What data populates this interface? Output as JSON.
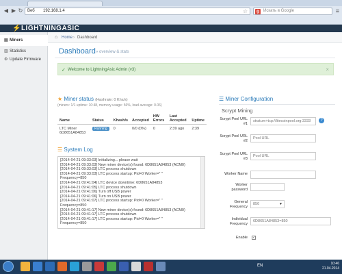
{
  "browser": {
    "site_label": "Веб",
    "url": "192.168.1.4",
    "search_placeholder": "Искать в Google"
  },
  "app": {
    "logo": "LIGHTNINGASIC"
  },
  "sidebar": {
    "items": [
      {
        "label": "Miners"
      },
      {
        "label": "Statistics"
      },
      {
        "label": "Update Firmware"
      }
    ]
  },
  "breadcrumb": {
    "home": "Home",
    "sep": "›",
    "current": "Dashboard"
  },
  "header": {
    "title": "Dashboard",
    "subtitle": "» overview & stats"
  },
  "alert": {
    "message": "Welcome to LightningAsic Admin (v3)"
  },
  "miner_status": {
    "title": "Miner status",
    "hashrate_label": "(Hashrate: 0 Khs/s)",
    "sub": "(miners: 1/1 uptime: 10:48, memory usage: 56%, load average: 0.06)",
    "columns": [
      "Name",
      "Status",
      "Khash/s",
      "Accepted",
      "HW Errors",
      "Last Accepted",
      "Uptime"
    ],
    "rows": [
      {
        "name": "LTC Miner 6D8651A84853",
        "status": "Running",
        "khash": "0",
        "accepted": "0/0 (0%)",
        "hw": "0",
        "last": "2:39 ago",
        "uptime": "2:39"
      }
    ]
  },
  "system_log": {
    "title": "System Log",
    "lines": [
      "[2014-04-21 09:33:03] Initializing... please wait",
      "[2014-04-21 09:33:03] New miner device(s) found: 6D8651A84853 (ACM0)",
      "[2014-04-21 09:33:03] LTC process shutdown",
      "[2014-04-21 09:33:03] LTC process startup: Pid=0 Worker=\"        \"",
      "Frequency=850",
      "[2014-04-21 09:41:04] LTC device downtime: 6D8651A84853",
      "[2014-04-21 09:41:05] LTC process shutdown",
      "[2014-04-21 09:41:06] Turn off USB power",
      "[2014-04-21 09:41:06] Turn on USB power",
      "[2014-04-21 09:41:07] LTC process startup: Pid=0 Worker=\"        \"",
      "Frequency=850",
      "[2014-04-21 09:41:17] New miner device(s) found: 6D8651A84853 (ACM0)",
      "[2014-04-21 09:41:17] LTC process shutdown",
      "[2014-04-21 09:41:17] LTC process startup: Pid=0 Worker=\"        \"",
      "Frequency=850"
    ]
  },
  "miner_config": {
    "title": "Miner Configuration",
    "section": "Scrypt Mining",
    "fields": [
      {
        "label": "Scrypt Pool URL #1",
        "value": "stratum+tcp://litecoinpool.org:3333"
      },
      {
        "label": "Scrypt Pool URL #2",
        "value": "Pool URL"
      },
      {
        "label": "Scrypt Pool URL #3",
        "value": "Pool URL"
      },
      {
        "label": "Worker Name",
        "value": ""
      },
      {
        "label": "Worker password",
        "value": ""
      },
      {
        "label": "General Frequency",
        "value": "850"
      },
      {
        "label": "Individual Frequency",
        "value": "6D8651A84853=850"
      },
      {
        "label": "Enable",
        "value": "✓"
      }
    ]
  },
  "taskbar": {
    "lang": "EN",
    "time": "10:46",
    "date": "21.04.2014"
  },
  "colors": {
    "accent": "#2a7ab8",
    "appbar": "#24394f",
    "success_bg": "#dff0d8",
    "taskbar": "#1f3c5c"
  }
}
